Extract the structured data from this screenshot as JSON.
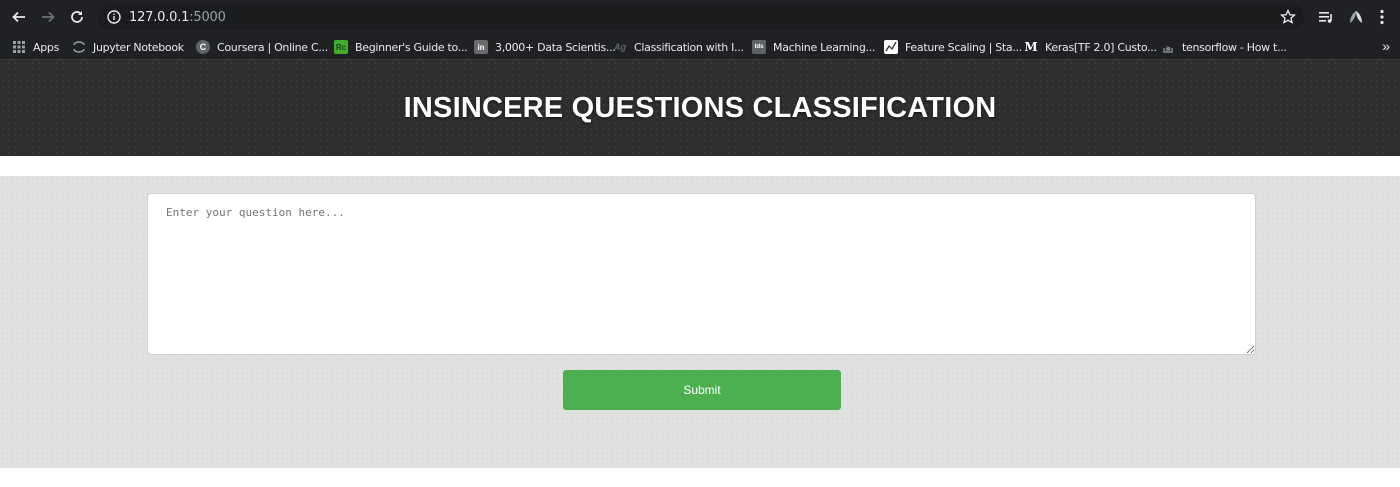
{
  "browser": {
    "url_host": "127.0.0.1",
    "url_port": ":5000"
  },
  "bookmarks": [
    {
      "label": "Apps",
      "icon": "apps-grid-icon",
      "color": "#9aa0a6"
    },
    {
      "label": "Jupyter Notebook",
      "icon": "jupyter-icon",
      "color": "#9aa0a6"
    },
    {
      "label": "Coursera | Online C...",
      "icon": "coursera-icon",
      "color": "#5f6368"
    },
    {
      "label": "Beginner's Guide to...",
      "icon": "rc-icon",
      "color": "#3fae2a"
    },
    {
      "label": "3,000+ Data Scientis...",
      "icon": "linkedin-icon",
      "color": "#6b6b6b"
    },
    {
      "label": "Classification with I...",
      "icon": "ag-icon",
      "color": "#202124"
    },
    {
      "label": "Machine Learning...",
      "icon": "tds-icon",
      "color": "#5f6368"
    },
    {
      "label": "Feature Scaling | Sta...",
      "icon": "chart-icon",
      "color": "#ffffff"
    },
    {
      "label": "Keras[TF 2.0] Custo...",
      "icon": "medium-icon",
      "color": "#202124"
    },
    {
      "label": "tensorflow - How t...",
      "icon": "stackoverflow-icon",
      "color": "#202124"
    }
  ],
  "page": {
    "title": "INSINCERE QUESTIONS CLASSIFICATION",
    "question_placeholder": "Enter your question here...",
    "submit_label": "Submit"
  },
  "colors": {
    "accent": "#4caf50",
    "banner": "#2d2d2d",
    "panel": "#e0e1e0"
  }
}
